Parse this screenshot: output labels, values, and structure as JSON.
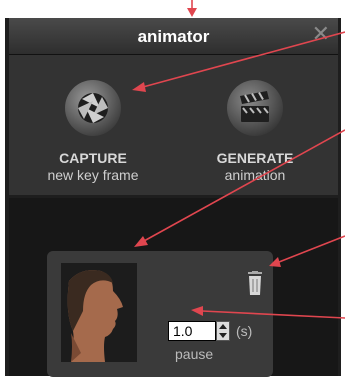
{
  "window": {
    "title": "animator",
    "close_glyph": "✕"
  },
  "toolbar": {
    "capture": {
      "label": "CAPTURE",
      "sublabel": "new key frame",
      "icon": "camera-shutter-icon"
    },
    "generate": {
      "label": "GENERATE",
      "sublabel": "animation",
      "icon": "clapperboard-icon"
    }
  },
  "keyframe": {
    "thumbnail_icon": "face-profile-thumbnail",
    "delete_icon": "trash-icon",
    "pause_value": "1.0",
    "pause_unit": "(s)",
    "pause_label": "pause"
  },
  "colors": {
    "annotation_arrow": "#e0464f",
    "panel_bg": "#1e1e1e",
    "toolbar_bg": "#333333"
  }
}
